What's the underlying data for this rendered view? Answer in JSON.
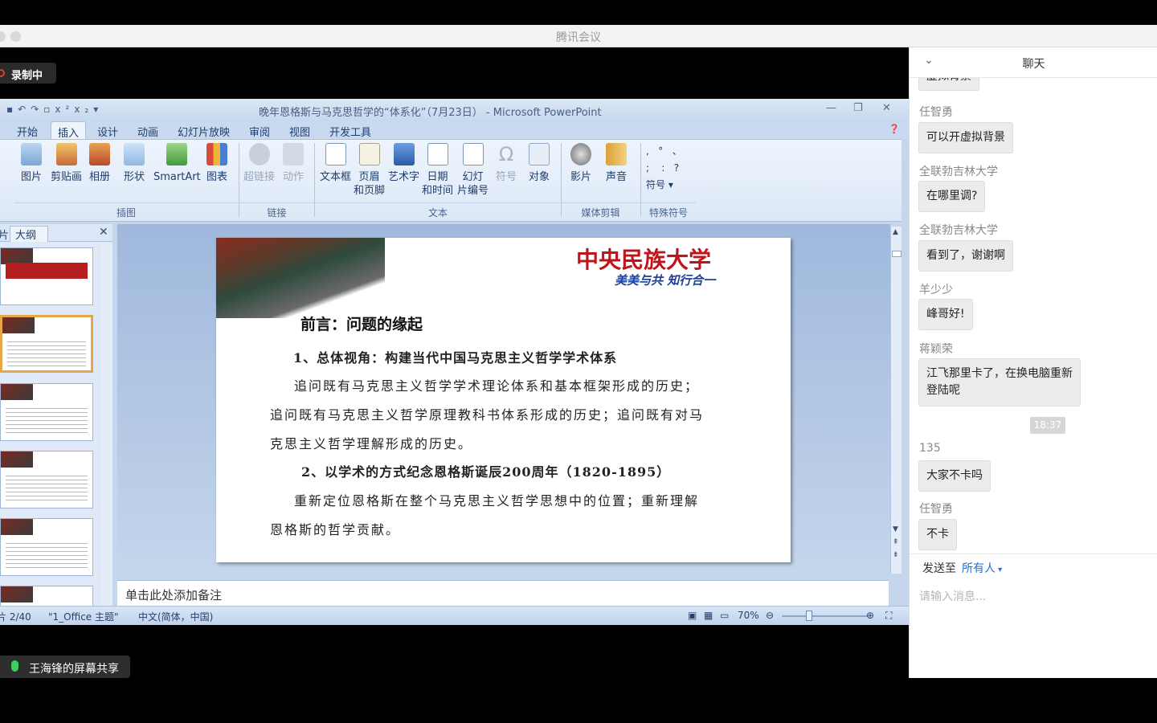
{
  "window": {
    "app_title": "腾讯会议"
  },
  "recording": {
    "label": "录制中"
  },
  "ppt": {
    "title": "晚年恩格斯与马克思哲学的“体系化”（7月23日） - Microsoft PowerPoint",
    "tabs": [
      "开始",
      "插入",
      "设计",
      "动画",
      "幻灯片放映",
      "审阅",
      "视图",
      "开发工具"
    ],
    "active_tab": "插入",
    "ribbon": {
      "buttons": [
        "图片",
        "剪贴画",
        "相册",
        "形状",
        "SmartArt",
        "图表",
        "超链接",
        "动作",
        "文本框",
        "页眉\n和页脚",
        "艺术字",
        "日期\n和时间",
        "幻灯\n片编号",
        "符号",
        "对象",
        "影片",
        "声音",
        "符号"
      ],
      "groups": [
        "插图",
        "链接",
        "文本",
        "媒体剪辑",
        "特殊符号"
      ]
    },
    "pane_tabs": [
      "片",
      "大纲"
    ],
    "slide": {
      "logo_text": "中央民族大学",
      "motto": "美美与共 知行合一",
      "heading": "前言：问题的缘起",
      "lines": [
        "1、总体视角：构建当代中国马克思主义哲学学术体系",
        "追问既有马克思主义哲学学术理论体系和基本框架形成的历史；",
        "追问既有马克思主义哲学原理教科书体系形成的历史；追问既有对马",
        "克思主义哲学理解形成的历史。",
        "2、以学术的方式纪念恩格斯诞辰200周年（1820-1895）",
        "重新定位恩格斯在整个马克思主义哲学思想中的位置；重新理解",
        "恩格斯的哲学贡献。"
      ]
    },
    "notes_placeholder": "单击此处添加备注",
    "status": {
      "slide": "片 2/40",
      "theme": "\"1_Office 主题\"",
      "language": "中文(简体，中国)",
      "zoom": "70%"
    }
  },
  "share_label": "王海锋的屏幕共享",
  "chat": {
    "title": "聊天",
    "top_partial": "虚拟背景",
    "messages": [
      {
        "sender": "任智勇",
        "text": "可以开虚拟背景"
      },
      {
        "sender": "全联勃吉林大学",
        "text": "在哪里调?"
      },
      {
        "sender": "全联勃吉林大学",
        "text": "看到了，谢谢啊"
      },
      {
        "sender": "羊少少",
        "text": "峰哥好!"
      },
      {
        "sender": "蒋颖荣",
        "text": "江飞那里卡了，在换电脑重新\n登陆呢"
      },
      {
        "sender": "135",
        "text": "大家不卡吗"
      },
      {
        "sender": "任智勇",
        "text": "不卡"
      }
    ],
    "timestamp": "18:37",
    "send_to_label": "发送至",
    "send_to_value": "所有人",
    "input_placeholder": "请输入消息..."
  }
}
